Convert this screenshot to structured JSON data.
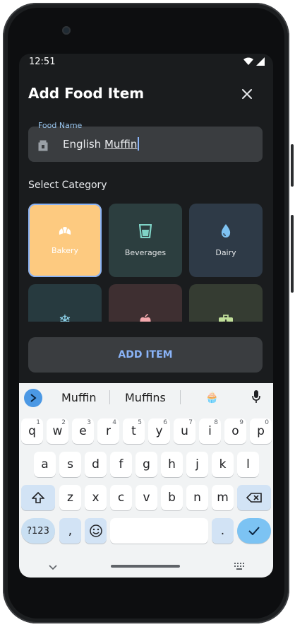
{
  "status_bar": {
    "time": "12:51"
  },
  "dialog": {
    "title": "Add Food Item",
    "food_name": {
      "label": "Food Name",
      "value_prefix": "English ",
      "value_underlined": "Muffin"
    },
    "section_title": "Select Category",
    "categories": [
      {
        "label": "Bakery",
        "icon": "croissant-icon",
        "selected": true
      },
      {
        "label": "Beverages",
        "icon": "cup-icon",
        "selected": false
      },
      {
        "label": "Dairy",
        "icon": "drop-icon",
        "selected": false
      },
      {
        "label": "",
        "icon": "snowflake-icon",
        "selected": false
      },
      {
        "label": "",
        "icon": "apple-icon",
        "selected": false
      },
      {
        "label": "",
        "icon": "first-aid-kit-icon",
        "selected": false
      }
    ],
    "add_button": "ADD ITEM"
  },
  "keyboard": {
    "suggestions": [
      "Muffin",
      "Muffins",
      "🧁"
    ],
    "row1": [
      {
        "k": "q",
        "n": "1"
      },
      {
        "k": "w",
        "n": "2"
      },
      {
        "k": "e",
        "n": "3"
      },
      {
        "k": "r",
        "n": "4"
      },
      {
        "k": "t",
        "n": "5"
      },
      {
        "k": "y",
        "n": "6"
      },
      {
        "k": "u",
        "n": "7"
      },
      {
        "k": "i",
        "n": "8"
      },
      {
        "k": "o",
        "n": "9"
      },
      {
        "k": "p",
        "n": "0"
      }
    ],
    "row2": [
      "a",
      "s",
      "d",
      "f",
      "g",
      "h",
      "j",
      "k",
      "l"
    ],
    "row3": [
      "z",
      "x",
      "c",
      "v",
      "b",
      "n",
      "m"
    ],
    "symbols_key": "?123",
    "comma_key": ",",
    "period_key": "."
  },
  "colors": {
    "accent": "#8ab4f8",
    "bakery_tile": "#fdca80",
    "beverages_tile": "#2c3e3f",
    "dairy_tile": "#2e3a47",
    "frozen_tile": "#273a3f",
    "produce_tile": "#3e2f31",
    "health_tile": "#353c32"
  }
}
